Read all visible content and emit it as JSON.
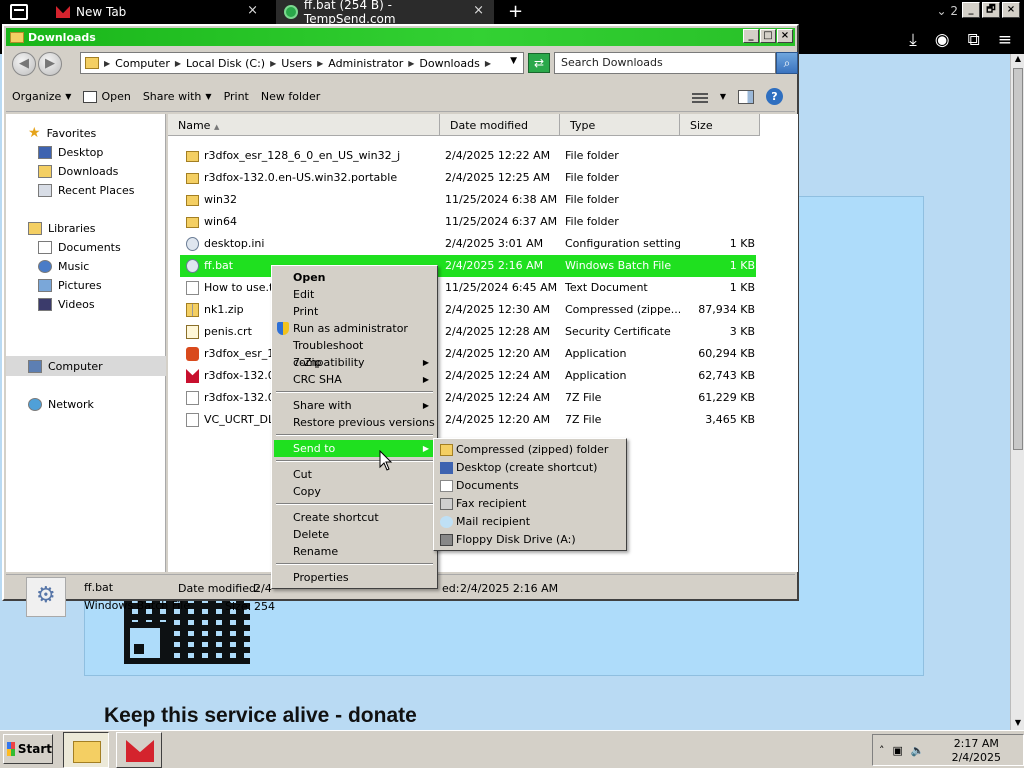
{
  "browser": {
    "tabs": [
      {
        "label": "New Tab",
        "close": "×"
      },
      {
        "label": "ff.bat (254 B) - TempSend.com",
        "close": "×"
      }
    ],
    "new_tab": "+",
    "tab_count": "2",
    "window_controls": [
      "_",
      "🗗",
      "×"
    ]
  },
  "webpage": {
    "donate_text": "Keep this service alive - donate"
  },
  "explorer": {
    "title": "Downloads",
    "title_controls": [
      "_",
      "□",
      "×"
    ],
    "breadcrumbs": [
      "Computer",
      "Local Disk (C:)",
      "Users",
      "Administrator",
      "Downloads"
    ],
    "search_placeholder": "Search Downloads",
    "toolbar": {
      "organize": "Organize",
      "open": "Open",
      "share_with": "Share with",
      "print": "Print",
      "new_folder": "New folder"
    },
    "nav": {
      "favorites": "Favorites",
      "desktop": "Desktop",
      "downloads": "Downloads",
      "recent_places": "Recent Places",
      "libraries": "Libraries",
      "documents": "Documents",
      "music": "Music",
      "pictures": "Pictures",
      "videos": "Videos",
      "computer": "Computer",
      "network": "Network"
    },
    "columns": {
      "name": "Name",
      "date": "Date modified",
      "type": "Type",
      "size": "Size"
    },
    "files": [
      {
        "name": "r3dfox_esr_128_6_0_en_US_win32_j",
        "date": "2/4/2025 12:22 AM",
        "type": "File folder",
        "size": "",
        "icon": "folder"
      },
      {
        "name": "r3dfox-132.0.en-US.win32.portable",
        "date": "2/4/2025 12:25 AM",
        "type": "File folder",
        "size": "",
        "icon": "folder"
      },
      {
        "name": "win32",
        "date": "11/25/2024 6:38 AM",
        "type": "File folder",
        "size": "",
        "icon": "folder"
      },
      {
        "name": "win64",
        "date": "11/25/2024 6:37 AM",
        "type": "File folder",
        "size": "",
        "icon": "folder"
      },
      {
        "name": "desktop.ini",
        "date": "2/4/2025 3:01 AM",
        "type": "Configuration settings",
        "size": "1 KB",
        "icon": "gear"
      },
      {
        "name": "ff.bat",
        "date": "2/4/2025 2:16 AM",
        "type": "Windows Batch File",
        "size": "1 KB",
        "icon": "gear"
      },
      {
        "name": "How to use.txt",
        "date": "11/25/2024 6:45 AM",
        "type": "Text Document",
        "size": "1 KB",
        "icon": "file"
      },
      {
        "name": "nk1.zip",
        "date": "2/4/2025 12:30 AM",
        "type": "Compressed (zippe...",
        "size": "87,934 KB",
        "icon": "zip"
      },
      {
        "name": "penis.crt",
        "date": "2/4/2025 12:28 AM",
        "type": "Security Certificate",
        "size": "3 KB",
        "icon": "cert"
      },
      {
        "name": "r3dfox_esr_12",
        "date": "2/4/2025 12:20 AM",
        "type": "Application",
        "size": "60,294 KB",
        "icon": "app"
      },
      {
        "name": "r3dfox-132.0.",
        "date": "2/4/2025 12:24 AM",
        "type": "Application",
        "size": "62,743 KB",
        "icon": "app2"
      },
      {
        "name": "r3dfox-132.0.",
        "date": "2/4/2025 12:24 AM",
        "type": "7Z File",
        "size": "61,229 KB",
        "icon": "file"
      },
      {
        "name": "VC_UCRT_DLL",
        "date": "2/4/2025 12:20 AM",
        "type": "7Z File",
        "size": "3,465 KB",
        "icon": "file"
      }
    ],
    "status": {
      "name": "ff.bat",
      "type": "Windows Batch File",
      "date_modified_label": "Date modified:",
      "date_modified_value": "2/4",
      "size_label": "Size:",
      "size_value": "254",
      "created_tail": "ed:",
      "created_value": "2/4/2025 2:16 AM"
    }
  },
  "context_menu": {
    "open": "Open",
    "edit": "Edit",
    "print": "Print",
    "run_as_admin": "Run as administrator",
    "troubleshoot": "Troubleshoot compatibility",
    "seven_zip": "7-Zip",
    "crc_sha": "CRC SHA",
    "share_with": "Share with",
    "restore": "Restore previous versions",
    "send_to": "Send to",
    "cut": "Cut",
    "copy": "Copy",
    "create_shortcut": "Create shortcut",
    "delete": "Delete",
    "rename": "Rename",
    "properties": "Properties"
  },
  "send_to_menu": [
    "Compressed (zipped) folder",
    "Desktop (create shortcut)",
    "Documents",
    "Fax recipient",
    "Mail recipient",
    "Floppy Disk Drive (A:)"
  ],
  "taskbar": {
    "start": "Start",
    "time": "2:17 AM",
    "date": "2/4/2025"
  },
  "colors": {
    "selection": "#1fe01f",
    "titlebar": "#28c028",
    "page_bg": "#b9daf3"
  }
}
